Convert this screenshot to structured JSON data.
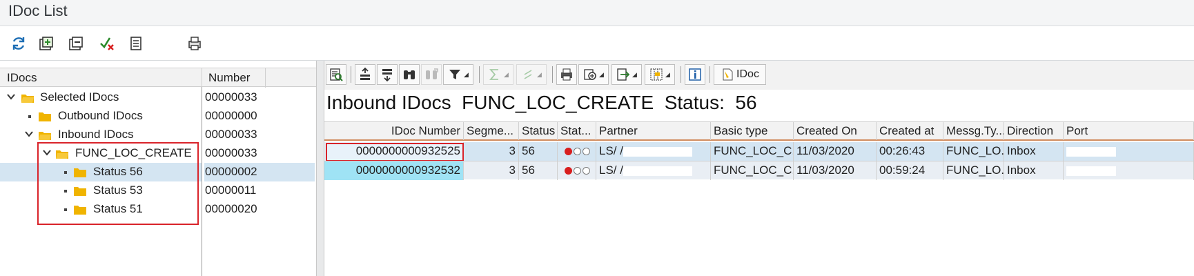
{
  "window": {
    "title": "IDoc List"
  },
  "app_toolbar": {
    "icons": [
      "refresh-icon",
      "expand-subtree-icon",
      "collapse-subtree-icon",
      "delete-selection-icon",
      "display-document-icon",
      "print-icon"
    ]
  },
  "tree": {
    "col_idocs": "IDocs",
    "col_number": "Number",
    "nodes": [
      {
        "label": "Selected IDocs",
        "number": "00000033"
      },
      {
        "label": "Outbound IDocs",
        "number": "00000000"
      },
      {
        "label": "Inbound IDocs",
        "number": "00000033"
      },
      {
        "label": "FUNC_LOC_CREATE",
        "number": "00000033"
      },
      {
        "label": "Status 56",
        "number": "00000002"
      },
      {
        "label": "Status 53",
        "number": "00000011"
      },
      {
        "label": "Status 51",
        "number": "00000020"
      }
    ]
  },
  "alv_toolbar": {
    "buttons": [
      "details-icon",
      "sort-ascending-icon",
      "sort-descending-icon",
      "find-icon",
      "find-next-icon",
      "filter-icon",
      "total-icon",
      "subtotal-icon",
      "print-icon",
      "views-icon",
      "export-icon",
      "layout-icon",
      "info-icon"
    ],
    "idoc_label": "IDoc"
  },
  "list": {
    "title_prefix": "Inbound IDocs",
    "title_basic_type": "FUNC_LOC_CREATE",
    "title_status_label": "Status:",
    "title_status_value": "56",
    "columns": [
      "IDoc Number",
      "Segme...",
      "Status",
      "Stat...",
      "Partner",
      "Basic type",
      "Created On",
      "Created at",
      "Messg.Ty...",
      "Direction",
      "Port"
    ],
    "rows": [
      {
        "idoc_number": "0000000000932525",
        "segments": "3",
        "status": "56",
        "partner": "LS/  /",
        "basic_type": "FUNC_LOC_C...",
        "created_on": "11/03/2020",
        "created_at": "00:26:43",
        "message_type": "FUNC_LO...",
        "direction": "Inbox",
        "port": ""
      },
      {
        "idoc_number": "0000000000932532",
        "segments": "3",
        "status": "56",
        "partner": "LS/  /",
        "basic_type": "FUNC_LOC_C...",
        "created_on": "11/03/2020",
        "created_at": "00:59:24",
        "message_type": "FUNC_LO...",
        "direction": "Inbox",
        "port": ""
      }
    ]
  },
  "colors": {
    "selection": "#d4e5f2",
    "highlight_cell": "#9fe3f5",
    "red_box": "#d9232a",
    "folder": "#f0b400",
    "status_red": "#d81e1e"
  }
}
